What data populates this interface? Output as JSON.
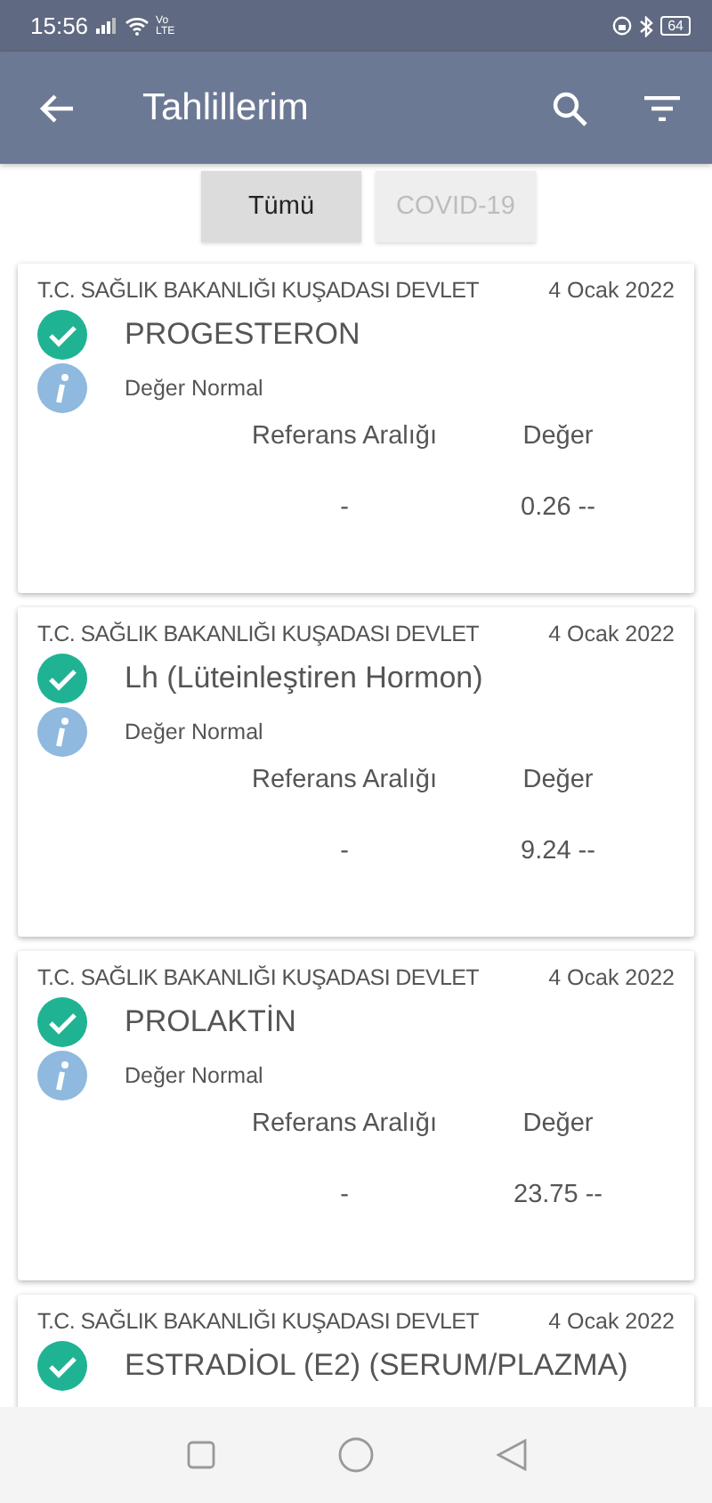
{
  "status_bar": {
    "time": "15:56",
    "network": "Vo LTE",
    "battery": "64"
  },
  "app_bar": {
    "title": "Tahlillerim"
  },
  "filters": [
    {
      "label": "Tümü",
      "selected": true
    },
    {
      "label": "COVID-19",
      "selected": false
    }
  ],
  "results": [
    {
      "hospital": "T.C. SAĞLIK BAKANLIĞI KUŞADASI DEVLET",
      "date": "4 Ocak 2022",
      "test": "PROGESTERON",
      "status": "Değer Normal",
      "reference_header": "Referans Aralığı",
      "value_header": "Değer",
      "reference": "-",
      "value": "0.26 --"
    },
    {
      "hospital": "T.C. SAĞLIK BAKANLIĞI KUŞADASI DEVLET",
      "date": "4 Ocak 2022",
      "test": "Lh (Lüteinleştiren Hormon)",
      "status": "Değer Normal",
      "reference_header": "Referans Aralığı",
      "value_header": "Değer",
      "reference": "-",
      "value": "9.24 --"
    },
    {
      "hospital": "T.C. SAĞLIK BAKANLIĞI KUŞADASI DEVLET",
      "date": "4 Ocak 2022",
      "test": "PROLAKTİN",
      "status": "Değer Normal",
      "reference_header": "Referans Aralığı",
      "value_header": "Değer",
      "reference": "-",
      "value": "23.75 --"
    },
    {
      "hospital": "T.C. SAĞLIK BAKANLIĞI KUŞADASI DEVLET",
      "date": "4 Ocak 2022",
      "test": "ESTRADİOL (E2) (SERUM/PLAZMA)"
    }
  ]
}
